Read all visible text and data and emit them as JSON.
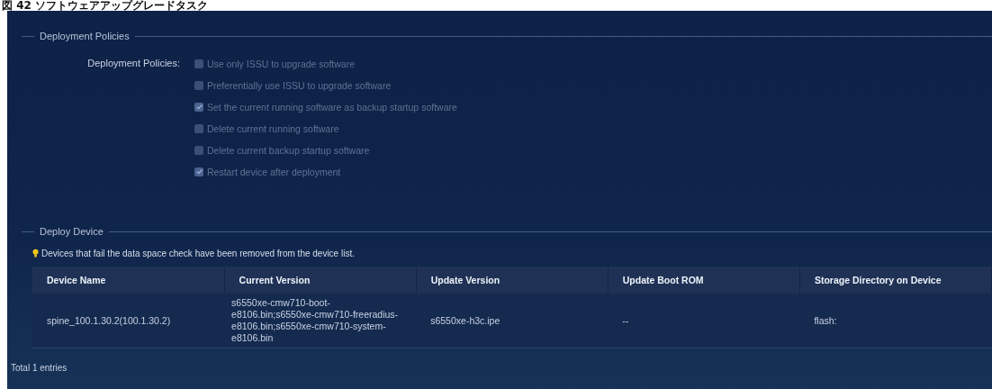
{
  "caption": "図 42 ソフトウェアアップグレードタスク",
  "policies": {
    "section_title": "Deployment Policies",
    "label": "Deployment Policies:",
    "options": [
      {
        "label": "Use only ISSU to upgrade software",
        "checked": false,
        "disabled": true
      },
      {
        "label": "Preferentially use ISSU to upgrade software",
        "checked": false,
        "disabled": true
      },
      {
        "label": "Set the current running software as backup startup software",
        "checked": true,
        "disabled": true
      },
      {
        "label": "Delete current running software",
        "checked": false,
        "disabled": true
      },
      {
        "label": "Delete current backup startup software",
        "checked": false,
        "disabled": true
      },
      {
        "label": "Restart device after deployment",
        "checked": true,
        "disabled": true
      }
    ]
  },
  "deploy": {
    "section_title": "Deploy Device",
    "tip": "Devices that fail the data space check have been removed from the device list.",
    "table": {
      "columns": [
        "Device Name",
        "Current Version",
        "Update Version",
        "Update Boot ROM",
        "Storage Directory on Device"
      ],
      "rows": [
        [
          "spine_100.1.30.2(100.1.30.2)",
          "s6550xe-cmw710-boot-e8106.bin;s6550xe-cmw710-freeradius-e8106.bin;s6550xe-cmw710-system-e8106.bin",
          "s6550xe-h3c.ipe",
          "--",
          "flash:"
        ]
      ]
    },
    "total": "Total 1 entries"
  }
}
